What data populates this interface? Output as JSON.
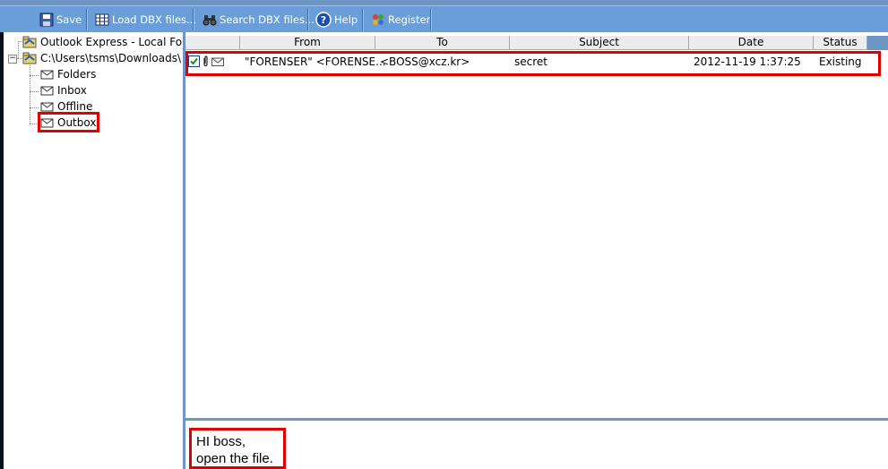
{
  "toolbar": {
    "save_label": "Save",
    "load_label": "Load DBX files...",
    "search_label": "Search DBX files...",
    "help_label": "Help",
    "register_label": "Register"
  },
  "tree": {
    "root_label": "Outlook Express - Local Folders",
    "path_label": "C:\\Users\\tsms\\Downloads\\",
    "children": [
      {
        "label": "Folders"
      },
      {
        "label": "Inbox"
      },
      {
        "label": "Offline"
      },
      {
        "label": "Outbox"
      }
    ]
  },
  "list": {
    "columns": [
      "From",
      "To",
      "Subject",
      "Date",
      "Status"
    ],
    "rows": [
      {
        "from": "\"FORENSER\" <FORENSE...",
        "to": "<BOSS@xcz.kr>",
        "subject": "secret",
        "date": "2012-11-19 1:37:25",
        "status": "Existing",
        "checked": true
      }
    ]
  },
  "preview": {
    "body": "HI boss,\nopen the file."
  },
  "colors": {
    "toolbar": "#6a9ed8",
    "pane_border": "#6e96c4",
    "highlight": "#e00000"
  }
}
